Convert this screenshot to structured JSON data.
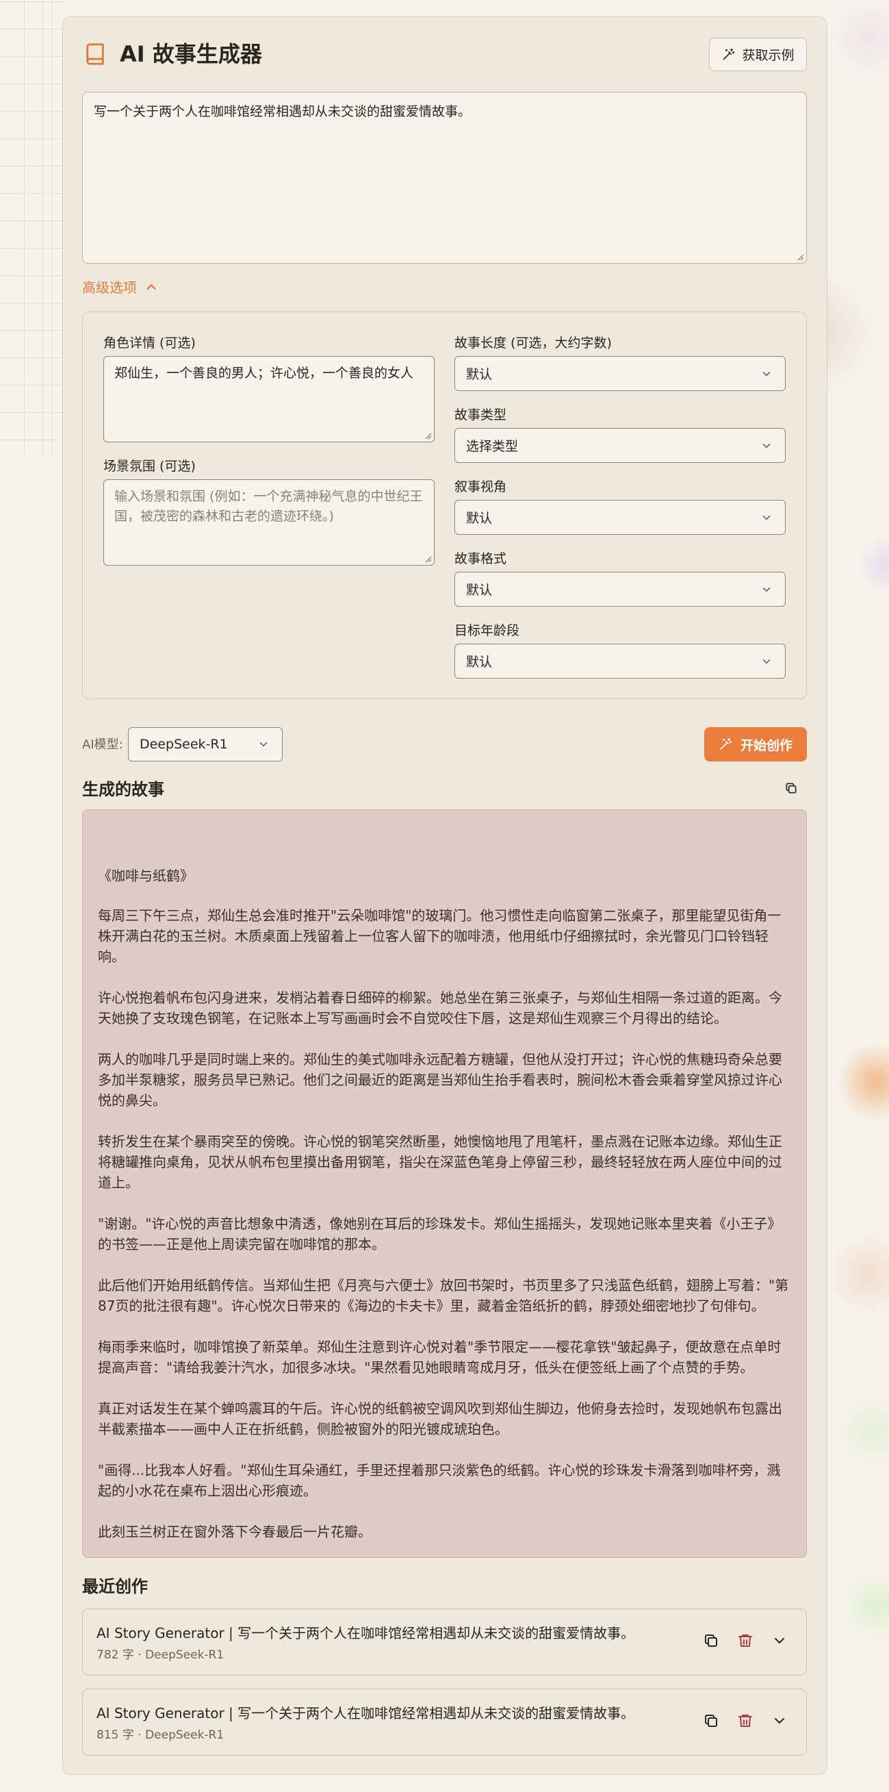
{
  "app": {
    "title": "AI 故事生成器",
    "example_button": "获取示例"
  },
  "prompt": {
    "value": "写一个关于两个人在咖啡馆经常相遇却从未交谈的甜蜜爱情故事。"
  },
  "advanced": {
    "toggle_label": "高级选项",
    "characters": {
      "label": "角色详情 (可选)",
      "value": "郑仙生，一个善良的男人；许心悦，一个善良的女人"
    },
    "setting": {
      "label": "场景氛围 (可选)",
      "placeholder": "输入场景和氛围 (例如：一个充满神秘气息的中世纪王国，被茂密的森林和古老的遗迹环绕。)"
    },
    "length": {
      "label": "故事长度 (可选，大约字数)",
      "value": "默认"
    },
    "genre": {
      "label": "故事类型",
      "value": "选择类型"
    },
    "pov": {
      "label": "叙事视角",
      "value": "默认"
    },
    "format": {
      "label": "故事格式",
      "value": "默认"
    },
    "age": {
      "label": "目标年龄段",
      "value": "默认"
    }
  },
  "model": {
    "label": "AI模型:",
    "value": "DeepSeek-R1"
  },
  "generate_button": "开始创作",
  "story": {
    "heading": "生成的故事",
    "title": "《咖啡与纸鹤》",
    "paragraphs": [
      "每周三下午三点，郑仙生总会准时推开\"云朵咖啡馆\"的玻璃门。他习惯性走向临窗第二张桌子，那里能望见街角一株开满白花的玉兰树。木质桌面上残留着上一位客人留下的咖啡渍，他用纸巾仔细擦拭时，余光瞥见门口铃铛轻响。",
      "许心悦抱着帆布包闪身进来，发梢沾着春日细碎的柳絮。她总坐在第三张桌子，与郑仙生相隔一条过道的距离。今天她换了支玫瑰色钢笔，在记账本上写写画画时会不自觉咬住下唇，这是郑仙生观察三个月得出的结论。",
      "两人的咖啡几乎是同时端上来的。郑仙生的美式咖啡永远配着方糖罐，但他从没打开过；许心悦的焦糖玛奇朵总要多加半泵糖浆，服务员早已熟记。他们之间最近的距离是当郑仙生抬手看表时，腕间松木香会乘着穿堂风掠过许心悦的鼻尖。",
      "转折发生在某个暴雨突至的傍晚。许心悦的钢笔突然断墨，她懊恼地甩了甩笔杆，墨点溅在记账本边缘。郑仙生正将糖罐推向桌角，见状从帆布包里摸出备用钢笔，指尖在深蓝色笔身上停留三秒，最终轻轻放在两人座位中间的过道上。",
      "\"谢谢。\"许心悦的声音比想象中清透，像她别在耳后的珍珠发卡。郑仙生摇摇头，发现她记账本里夹着《小王子》的书签——正是他上周读完留在咖啡馆的那本。",
      "此后他们开始用纸鹤传信。当郑仙生把《月亮与六便士》放回书架时，书页里多了只浅蓝色纸鹤，翅膀上写着：\"第87页的批注很有趣\"。许心悦次日带来的《海边的卡夫卡》里，藏着金箔纸折的鹤，脖颈处细密地抄了句俳句。",
      "梅雨季来临时，咖啡馆换了新菜单。郑仙生注意到许心悦对着\"季节限定——樱花拿铁\"皱起鼻子，便故意在点单时提高声音：\"请给我姜汁汽水，加很多冰块。\"果然看见她眼睛弯成月牙，低头在便签纸上画了个点赞的手势。",
      "真正对话发生在某个蝉鸣震耳的午后。许心悦的纸鹤被空调风吹到郑仙生脚边，他俯身去捡时，发现她帆布包露出半截素描本——画中人正在折纸鹤，侧脸被窗外的阳光镀成琥珀色。",
      "\"画得...比我本人好看。\"郑仙生耳朵通红，手里还捏着那只淡紫色的纸鹤。许心悦的珍珠发卡滑落到咖啡杯旁，溅起的小水花在桌布上洇出心形痕迹。",
      "此刻玉兰树正在窗外落下今春最后一片花瓣。"
    ]
  },
  "recent": {
    "heading": "最近创作",
    "items": [
      {
        "title": "AI Story Generator | 写一个关于两个人在咖啡馆经常相遇却从未交谈的甜蜜爱情故事。",
        "meta": "782 字 · DeepSeek-R1"
      },
      {
        "title": "AI Story Generator | 写一个关于两个人在咖啡馆经常相遇却从未交谈的甜蜜爱情故事。",
        "meta": "815 字 · DeepSeek-R1"
      }
    ]
  },
  "colors": {
    "accent": "#ea7d3c",
    "card_bg": "#efe8dd",
    "page_bg": "#f7f3ec",
    "story_bg": "#dfcbc8",
    "delete": "#b23a3a"
  }
}
